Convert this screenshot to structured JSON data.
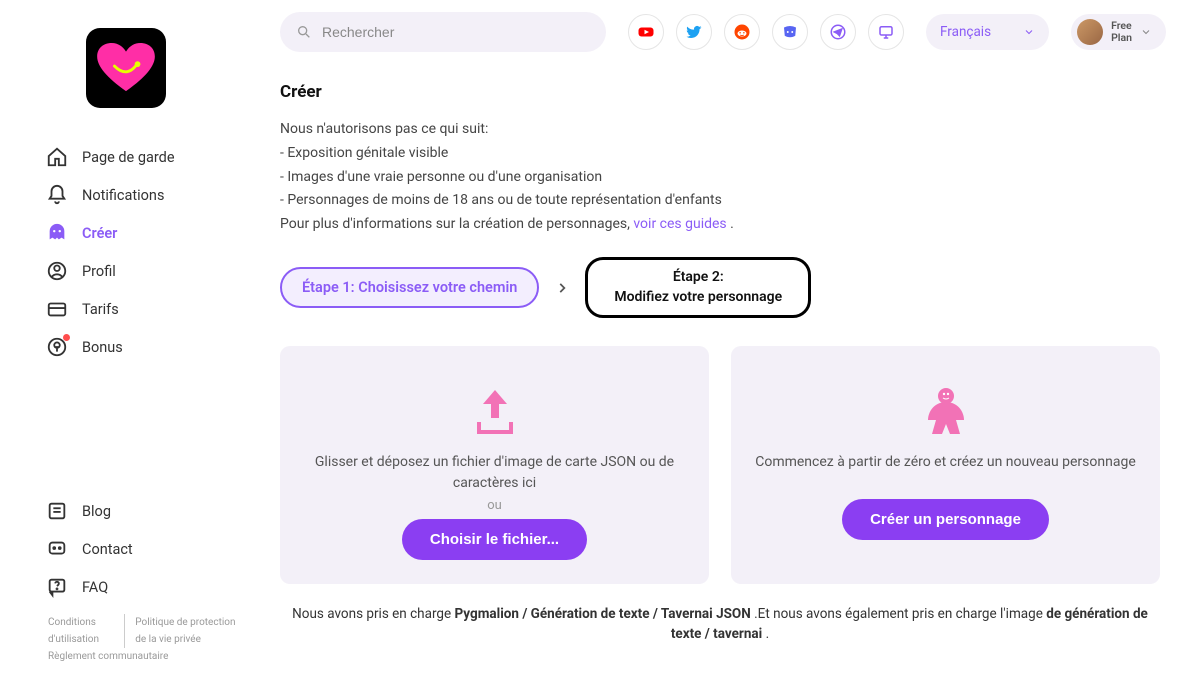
{
  "search": {
    "placeholder": "Rechercher"
  },
  "language": "Français",
  "plan": {
    "line1": "Free",
    "line2": "Plan"
  },
  "sidebar": {
    "nav": {
      "home": "Page de garde",
      "notifications": "Notifications",
      "create": "Créer",
      "profile": "Profil",
      "pricing": "Tarifs",
      "bonus": "Bonus"
    },
    "secondary": {
      "blog": "Blog",
      "contact": "Contact",
      "faq": "FAQ"
    },
    "footer": {
      "terms": "Conditions d'utilisation",
      "privacy": "Politique de protection de la vie privée",
      "community": "Règlement communautaire"
    }
  },
  "page": {
    "heading": "Créer",
    "intro": "Nous n'autorisons pas ce qui suit:",
    "rule1": "- Exposition génitale visible",
    "rule2": "- Images d'une vraie personne ou d'une organisation",
    "rule3": "- Personnages de moins de 18 ans ou de toute représentation d'enfants",
    "more_pre": "Pour plus d'informations sur la création de personnages, ",
    "more_link": "voir ces guides",
    "more_post": " .",
    "step1_label": "Étape 1:",
    "step1_text": "Choisissez votre chemin",
    "step2_label": "Étape 2:",
    "step2_text": "Modifiez votre personnage",
    "upload": {
      "desc": "Glisser et déposez un fichier d'image de carte JSON ou de caractères ici",
      "or": "ou",
      "button": "Choisir le fichier..."
    },
    "create": {
      "desc": "Commencez à partir de zéro et créez un nouveau personnage",
      "button": "Créer un personnage"
    },
    "support_pre": "Nous avons pris en charge ",
    "support_b1": "Pygmalion / Génération de texte / Tavernai JSON",
    "support_mid": " .Et nous avons également pris en charge l'image ",
    "support_b2": "de génération de texte / tavernai",
    "support_post": " ."
  }
}
